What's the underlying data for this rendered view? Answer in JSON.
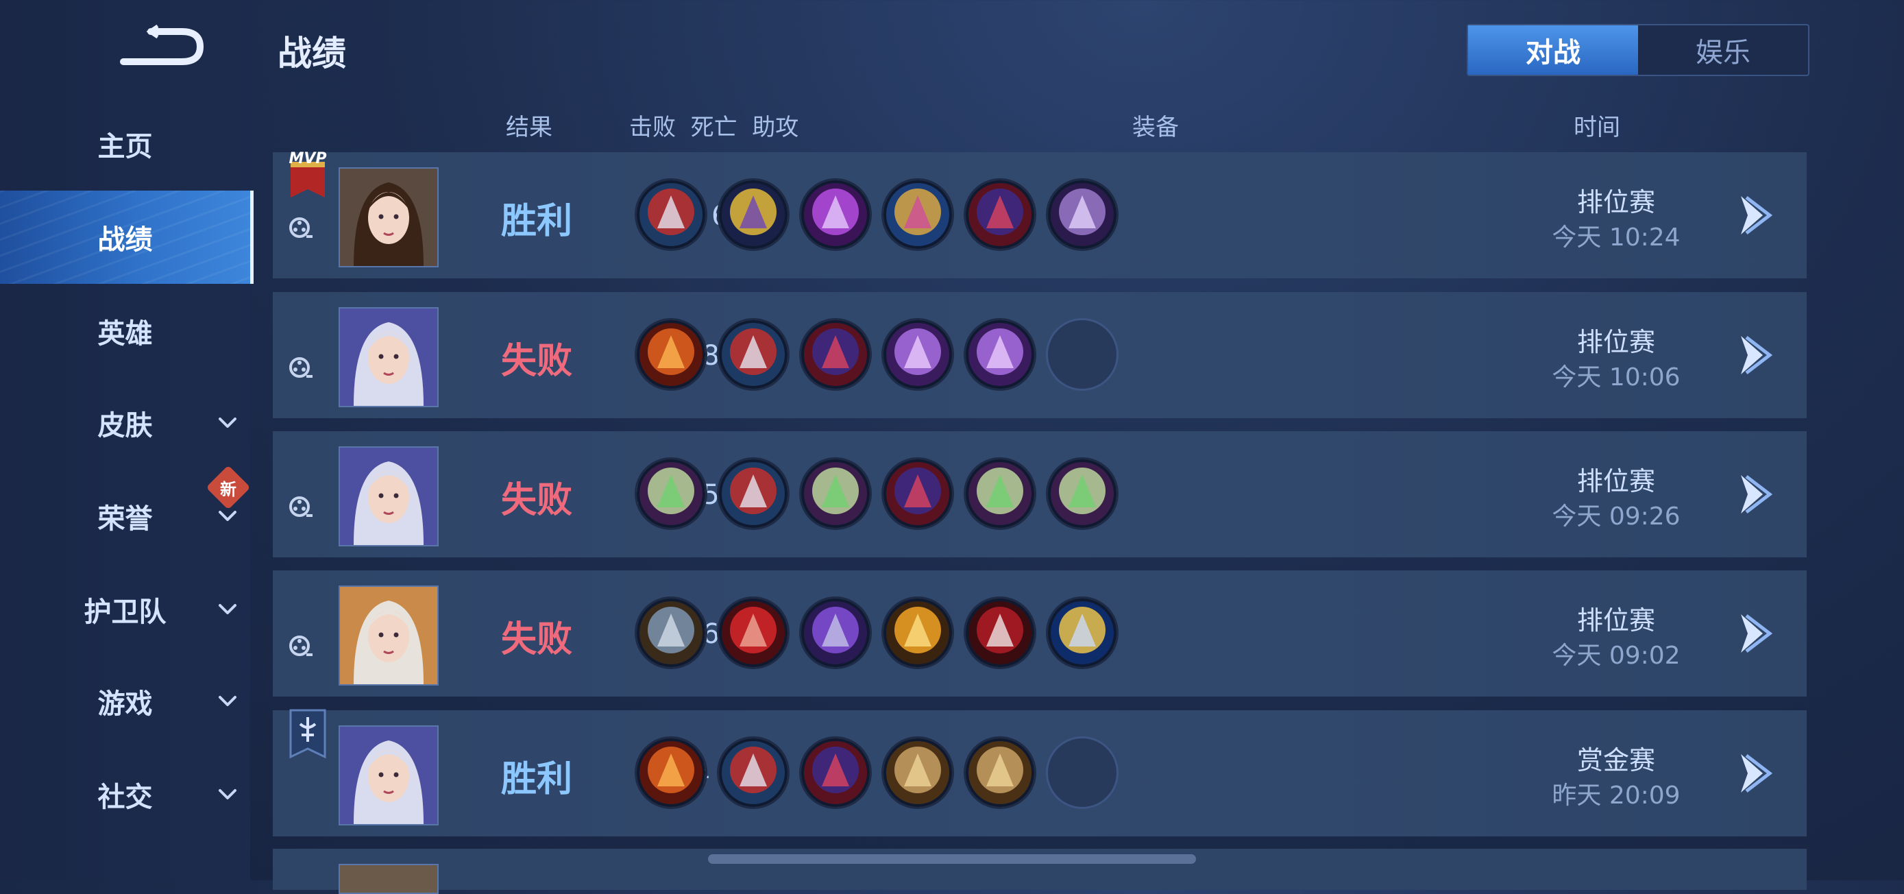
{
  "sidebar": {
    "items": [
      {
        "label": "主页",
        "chevron": false,
        "active": false
      },
      {
        "label": "战绩",
        "chevron": false,
        "active": true
      },
      {
        "label": "英雄",
        "chevron": false,
        "active": false
      },
      {
        "label": "皮肤",
        "chevron": true,
        "active": false
      },
      {
        "label": "荣誉",
        "chevron": true,
        "active": false
      },
      {
        "label": "护卫队",
        "chevron": true,
        "active": false
      },
      {
        "label": "游戏",
        "chevron": true,
        "active": false
      },
      {
        "label": "社交",
        "chevron": true,
        "active": false
      }
    ],
    "new_badge": "新"
  },
  "header": {
    "title": "战绩",
    "tabs": [
      {
        "label": "对战",
        "selected": true
      },
      {
        "label": "娱乐",
        "selected": false
      }
    ]
  },
  "columns": {
    "result": "结果",
    "kda": "击败  死亡  助攻",
    "items": "装备",
    "time": "时间"
  },
  "matches": [
    {
      "result": "胜利",
      "outcome": "win",
      "kda": "11 / 6 / 2",
      "mode": "排位赛",
      "time": "今天 10:24",
      "badge": "MVP",
      "hero": "hero-female-dark-hair",
      "items": [
        "boots-red-icon",
        "golden-chalice-icon",
        "purple-scythe-icon",
        "blue-orb-icon",
        "wizard-hat-icon",
        "spellbook-icon"
      ]
    },
    {
      "result": "失败",
      "outcome": "lose",
      "kda": "3 / 8 / 1",
      "mode": "排位赛",
      "time": "今天 10:06",
      "badge": "",
      "hero": "hero-silver-hair",
      "items": [
        "red-rose-icon",
        "boots-red-icon",
        "wizard-hat-icon",
        "purple-staff-icon",
        "purple-staff-icon",
        "empty"
      ]
    },
    {
      "result": "失败",
      "outcome": "lose",
      "kda": "9 / 15 / 10",
      "mode": "排位赛",
      "time": "今天 09:26",
      "badge": "",
      "hero": "hero-silver-hair",
      "items": [
        "green-book-icon",
        "boots-red-icon",
        "green-book-icon",
        "wizard-hat-icon",
        "green-book-icon",
        "green-book-icon"
      ]
    },
    {
      "result": "失败",
      "outcome": "lose",
      "kda": "6 / 6 / 6",
      "mode": "排位赛",
      "time": "今天 09:02",
      "badge": "",
      "hero": "hero-white-hair-warrior",
      "items": [
        "armored-boots-icon",
        "red-helmet-icon",
        "purple-axe-icon",
        "golden-flame-icon",
        "red-blade-icon",
        "blue-spear-icon"
      ]
    },
    {
      "result": "胜利",
      "outcome": "win",
      "kda": "1 / 4 / 19",
      "mode": "赏金赛",
      "time": "昨天 20:09",
      "badge": "bounty",
      "hero": "hero-silver-hair",
      "items": [
        "red-rose-icon",
        "boots-red-icon",
        "wizard-hat-icon",
        "wooden-crate-icon",
        "wooden-crate-icon",
        "empty"
      ]
    }
  ],
  "colors": {
    "win": "#8cc8ff",
    "lose": "#ee6a7c",
    "accent": "#2f72c9"
  }
}
